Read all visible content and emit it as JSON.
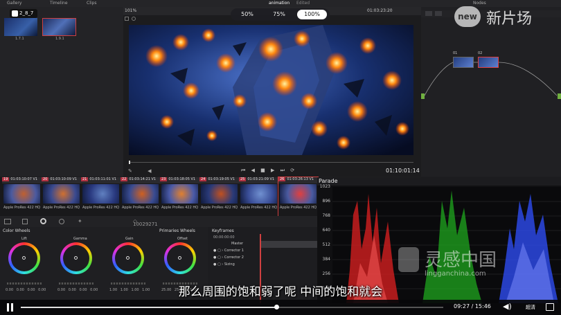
{
  "topbar": {
    "gallery": "Gallery",
    "timeline": "Timeline",
    "clips": "Clips",
    "title": "animation",
    "edited": "Edited",
    "timecode": "01:03:23:20",
    "nodes": "Nodes"
  },
  "viewer": {
    "zoom": "101%",
    "timecode": "01:10:01:14"
  },
  "player": {
    "episode": "2_8_7",
    "time_current": "09:27",
    "time_total": "15:46",
    "quality": "超清",
    "progress_percent": 60.5,
    "speeds": [
      "50%",
      "75%",
      "100%"
    ],
    "selected_speed": "100%"
  },
  "watermark": {
    "top": "new 新片场",
    "center": "灵感中国",
    "url": "lingganchina.com"
  },
  "gallery": {
    "thumbs": [
      "1.7.1",
      "1.9.1"
    ]
  },
  "nodes": {
    "n1": "01",
    "n2": "02"
  },
  "clips": [
    {
      "num": "19",
      "tc": "01:03:10:07",
      "track": "V1",
      "label": "Apple ProRes 422 HQ"
    },
    {
      "num": "20",
      "tc": "01:03:10:09",
      "track": "V1",
      "label": "Apple ProRes 422 HQ"
    },
    {
      "num": "21",
      "tc": "01:03:11:01",
      "track": "V1",
      "label": "Apple ProRes 422 HQ"
    },
    {
      "num": "22",
      "tc": "01:03:14:21",
      "track": "V1",
      "label": "Apple ProRes 422 HQ"
    },
    {
      "num": "23",
      "tc": "01:03:18:05",
      "track": "V1",
      "label": "Apple ProRes 422 HQ"
    },
    {
      "num": "24",
      "tc": "01:03:19:05",
      "track": "V1",
      "label": "Apple ProRes 422 HQ"
    },
    {
      "num": "25",
      "tc": "01:03:21:09",
      "track": "V1",
      "label": "Apple ProRes 422 HQ"
    },
    {
      "num": "26",
      "tc": "01:03:26:13",
      "track": "V1",
      "label": "Apple ProRes 422 HQ"
    }
  ],
  "overlay_id": "10029271",
  "color": {
    "title": "Color Wheels",
    "primaries": "Primaries Wheels",
    "keyframes": "Keyframes",
    "kf_tc": "00:00:00:00",
    "wheels": [
      {
        "name": "Lift",
        "nums": "0.00  0.00  0.00  0.00"
      },
      {
        "name": "Gamma",
        "nums": "0.00  0.00  0.00  0.00"
      },
      {
        "name": "Gain",
        "nums": "1.00  1.00  1.00  1.00"
      },
      {
        "name": "Offset",
        "nums": "25.00  25.00  25.00"
      }
    ],
    "kf_rows": [
      "Master",
      "Corrector 1",
      "Corrector 2",
      "Sizing"
    ]
  },
  "parade": {
    "title": "Parade",
    "scale": [
      "1023",
      "896",
      "768",
      "640",
      "512",
      "384",
      "256",
      "128"
    ]
  },
  "subtitle": "那么周围的饱和弱了呢  中间的饱和就会"
}
